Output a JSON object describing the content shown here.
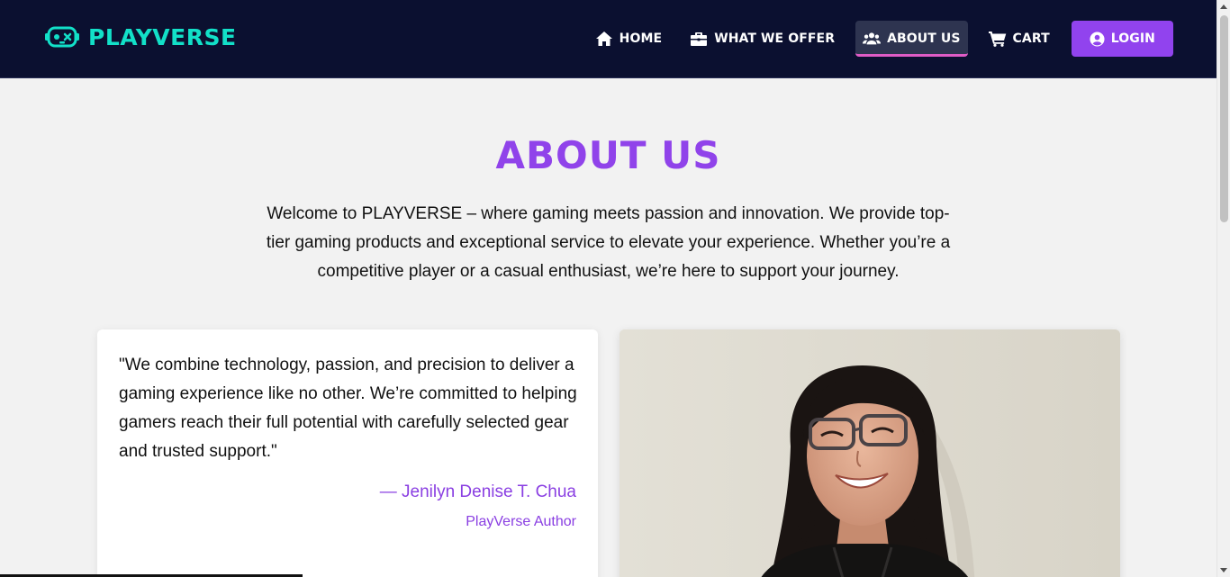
{
  "brand": {
    "name": "PLAYVERSE",
    "color": "#12e0c8",
    "icon": "robot-controller-icon"
  },
  "nav": {
    "items": [
      {
        "label": "HOME",
        "icon": "home-icon"
      },
      {
        "label": "WHAT WE OFFER",
        "icon": "briefcase-icon"
      },
      {
        "label": "ABOUT US",
        "icon": "users-icon",
        "active": true
      },
      {
        "label": "CART",
        "icon": "cart-icon"
      }
    ],
    "login": {
      "label": "LOGIN",
      "icon": "user-circle-icon"
    }
  },
  "main": {
    "title": "ABOUT US",
    "intro": "Welcome to PLAYVERSE – where gaming meets passion and innovation. We provide top-tier gaming products and exceptional service to elevate your experience. Whether you’re a competitive player or a casual enthusiast, we’re here to support your journey.",
    "quote": {
      "text": "\"We combine technology, passion, and precision to deliver a gaming experience like no other. We’re committed to helping gamers reach their full potential with carefully selected gear and trusted support.\"",
      "author": "— Jenilyn Denise T. Chua",
      "role": "PlayVerse Author"
    },
    "photo": {
      "subject": "author-portrait"
    }
  },
  "colors": {
    "header_bg": "#0b1030",
    "accent_purple": "#9043ea",
    "active_underline": "#e05cc6",
    "page_bg": "#f2f2f2"
  }
}
